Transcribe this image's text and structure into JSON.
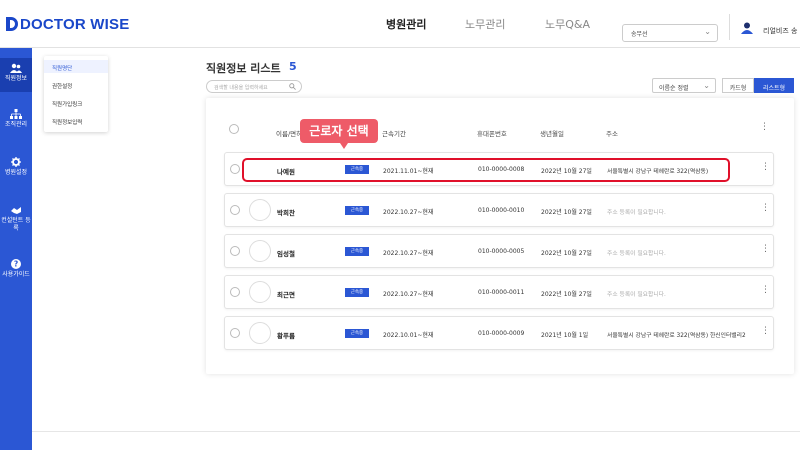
{
  "brand": {
    "logo_text": "DOCTOR WISE",
    "accent": "#2b57d4",
    "sidebar_bg": "#2b57d4",
    "highlight_color": "#e0102a",
    "tip_color": "#ee5b68"
  },
  "topnav": [
    {
      "label": "병원관리",
      "active": true
    },
    {
      "label": "노무관리",
      "active": false
    },
    {
      "label": "노무Q&A",
      "active": false
    }
  ],
  "branch_select": {
    "value": "송무선"
  },
  "user": {
    "name": "리얼비즈 송",
    "icon": "user-icon"
  },
  "sidebar": [
    {
      "label": "직원정보",
      "icon": "people-icon",
      "active": true
    },
    {
      "label": "조직관리",
      "icon": "org-chart-icon",
      "active": false
    },
    {
      "label": "병원설정",
      "icon": "gear-icon",
      "active": false
    },
    {
      "label": "컨설턴트 등록",
      "icon": "consultant-icon",
      "active": false
    },
    {
      "label": "사용가이드",
      "icon": "help-icon",
      "active": false
    }
  ],
  "submenu": [
    {
      "label": "직원명단",
      "active": true
    },
    {
      "label": "권한설정",
      "active": false
    },
    {
      "label": "직원가입링크",
      "active": false
    },
    {
      "label": "직원정보입력",
      "active": false
    }
  ],
  "page": {
    "title": "직원정보 리스트",
    "count": "5",
    "search_placeholder": "검색할 내용을 입력하세요"
  },
  "controls": {
    "sort_value": "이름순 정렬",
    "view_card": "카드형",
    "view_list": "리스트형"
  },
  "table": {
    "headers": {
      "name": "이름/면허",
      "period": "근속기간",
      "phone": "휴대폰번호",
      "birth": "생년월일",
      "address": "주소"
    },
    "rows": [
      {
        "name": "나예원",
        "badge": "근속중",
        "period": "2021.11.01~현재",
        "phone": "010-0000-0008",
        "birth": "2022년 10월 27일",
        "address": "서울특별시 강남구 테헤란로 322(역삼동)",
        "has_address": true
      },
      {
        "name": "박희찬",
        "badge": "근속중",
        "period": "2022.10.27~현재",
        "phone": "010-0000-0010",
        "birth": "2022년 10월 27일",
        "address": "주소 등록이 필요합니다.",
        "has_address": false
      },
      {
        "name": "임성철",
        "badge": "근속중",
        "period": "2022.10.27~현재",
        "phone": "010-0000-0005",
        "birth": "2022년 10월 27일",
        "address": "주소 등록이 필요합니다.",
        "has_address": false
      },
      {
        "name": "최근면",
        "badge": "근속중",
        "period": "2022.10.27~현재",
        "phone": "010-0000-0011",
        "birth": "2022년 10월 27일",
        "address": "주소 등록이 필요합니다.",
        "has_address": false
      },
      {
        "name": "황푸름",
        "badge": "근속중",
        "period": "2022.10.01~현재",
        "phone": "010-0000-0009",
        "birth": "2021년 10월 1일",
        "address": "서울특별시 강남구 테헤란로 322(역삼동) 한신인터밸리2",
        "has_address": true
      }
    ]
  },
  "annotation": {
    "tip_text": "근로자 선택"
  }
}
